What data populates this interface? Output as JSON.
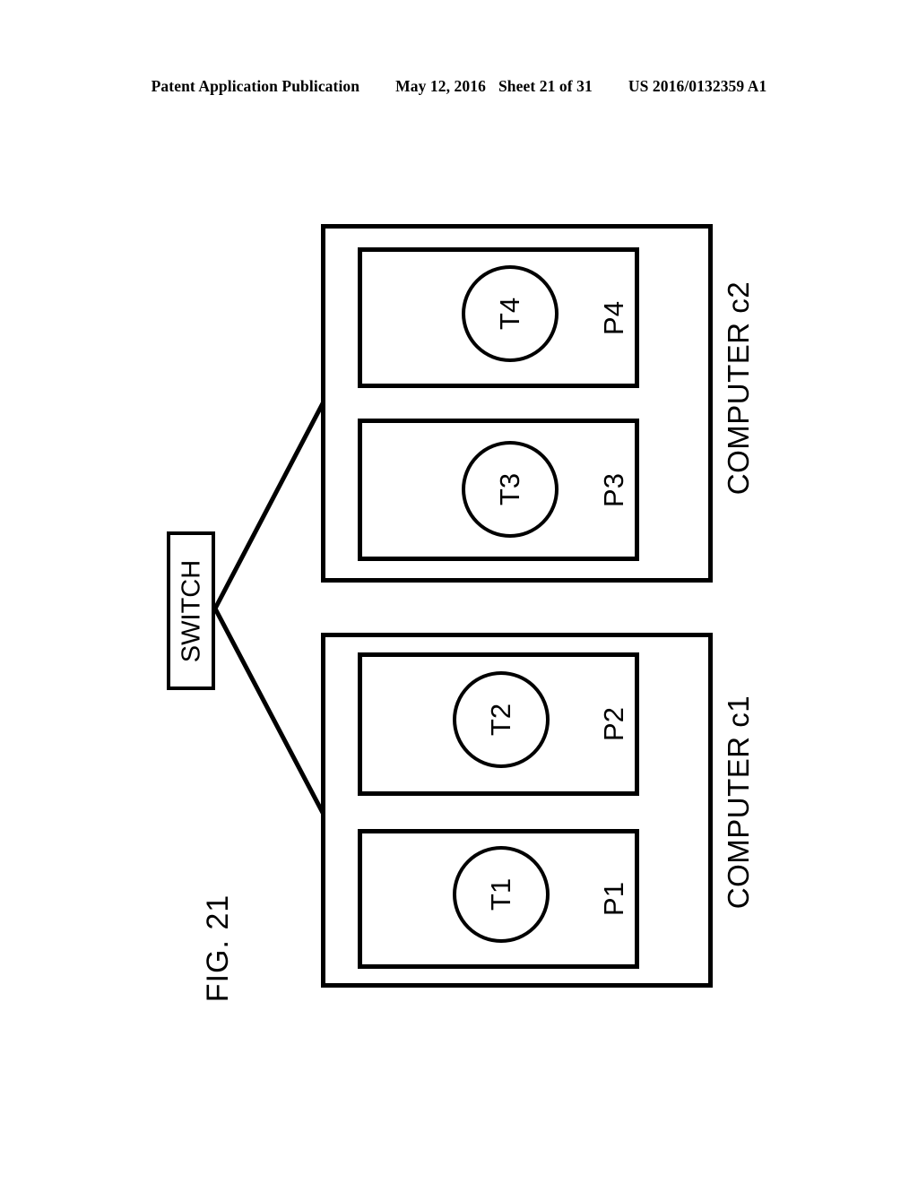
{
  "header": {
    "publication": "Patent Application Publication",
    "date": "May 12, 2016",
    "sheet": "Sheet 21 of 31",
    "patent_number": "US 2016/0132359 A1"
  },
  "figure": {
    "label": "FIG. 21"
  },
  "diagram": {
    "switch": {
      "label": "SWITCH"
    },
    "computers": [
      {
        "id": "c2",
        "label": "COMPUTER c2",
        "processes": [
          {
            "id": "p4",
            "label": "P4",
            "thread": {
              "id": "t4",
              "label": "T4"
            }
          },
          {
            "id": "p3",
            "label": "P3",
            "thread": {
              "id": "t3",
              "label": "T3"
            }
          }
        ]
      },
      {
        "id": "c1",
        "label": "COMPUTER c1",
        "processes": [
          {
            "id": "p2",
            "label": "P2",
            "thread": {
              "id": "t2",
              "label": "T2"
            }
          },
          {
            "id": "p1",
            "label": "P1",
            "thread": {
              "id": "t1",
              "label": "T1"
            }
          }
        ]
      }
    ],
    "connections": [
      {
        "from": "switch",
        "to": "c2"
      },
      {
        "from": "switch",
        "to": "c1"
      }
    ],
    "colors": {
      "stroke": "#000000",
      "background": "#ffffff"
    }
  }
}
